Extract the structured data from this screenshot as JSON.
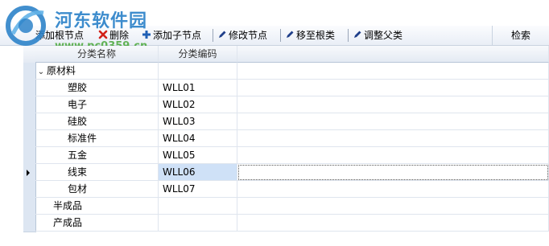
{
  "logo": {
    "title": "河东软件园",
    "url": "www.pc0359.cn"
  },
  "toolbar": {
    "add_root": "添加根节点",
    "delete": "删除",
    "add_child": "添加子节点",
    "edit": "修改节点",
    "move_root": "移至根类",
    "adjust_parent": "调整父类",
    "search": "检索"
  },
  "columns": {
    "name": "分类名称",
    "code": "分类编码"
  },
  "rows": [
    {
      "name": "原材料",
      "code": "",
      "expanded": true
    },
    {
      "name": "塑胶",
      "code": "WLL01"
    },
    {
      "name": "电子",
      "code": "WLL02"
    },
    {
      "name": "硅胶",
      "code": "WLL03"
    },
    {
      "name": "标准件",
      "code": "WLL04"
    },
    {
      "name": "五金",
      "code": "WLL05"
    },
    {
      "name": "线束",
      "code": "WLL06",
      "selected": true
    },
    {
      "name": "包材",
      "code": "WLL07"
    },
    {
      "name": "半成品",
      "code": ""
    },
    {
      "name": "产成品",
      "code": ""
    }
  ],
  "colors": {
    "accent": "#2d83c9",
    "selection": "#cfe1f7"
  }
}
